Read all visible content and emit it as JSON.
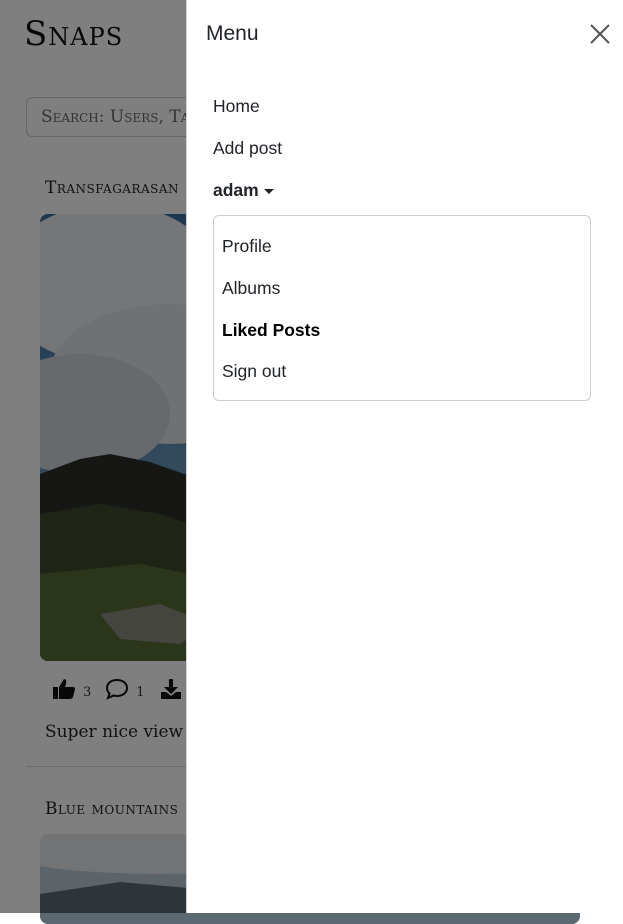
{
  "app": {
    "brand": "Snaps"
  },
  "search": {
    "placeholder": "Search: Users, Tags, Posts"
  },
  "posts": [
    {
      "title": "Transfagarasan",
      "likes": "3",
      "comments": "1",
      "caption": "Super nice view transfagarasan"
    },
    {
      "title": "Blue mountains"
    }
  ],
  "menu": {
    "title": "Menu",
    "items": [
      {
        "label": "Home"
      },
      {
        "label": "Add post"
      }
    ],
    "user": {
      "name": "adam",
      "dropdown": [
        {
          "label": "Profile",
          "active": false
        },
        {
          "label": "Albums",
          "active": false
        },
        {
          "label": "Liked Posts",
          "active": true
        },
        {
          "label": "Sign out",
          "active": false
        }
      ]
    }
  },
  "icons": {
    "close": "close-icon",
    "like": "thumbs-up-icon",
    "comment": "comment-icon",
    "download": "download-icon",
    "caret": "caret-down-icon"
  },
  "colors": {
    "overlay": "#000000",
    "menu_bg": "#ffffff",
    "text": "#212529"
  }
}
